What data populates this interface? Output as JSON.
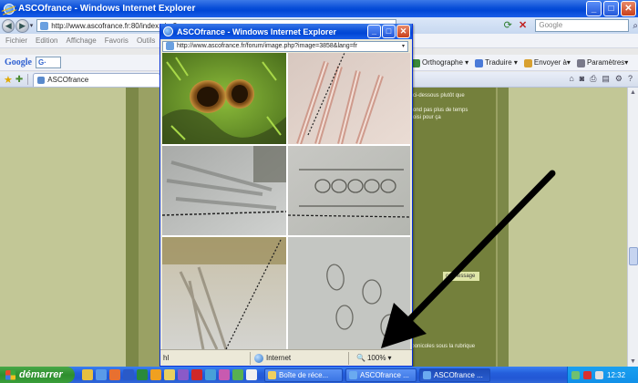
{
  "main_window": {
    "title": "ASCOfrance - Windows Internet Explorer",
    "address": "http://www.ascofrance.fr:80/index.php?...",
    "search_placeholder": "Google",
    "menu": [
      "Fichier",
      "Edition",
      "Affichage",
      "Favoris",
      "Outils"
    ],
    "google_label": "Google",
    "google_g": "G·",
    "toolbar_items": [
      "Orthographe ▾",
      "Traduire ▾",
      "Envoyer à▾",
      "Paramètres▾"
    ],
    "tab_label": "ASCOfrance"
  },
  "page_text": {
    "line1": "ci-dessous plutôt que",
    "line2": "ond pas plus de temps",
    "line3": "oisi pour ça",
    "message_button": "ce message",
    "bottom_text": "Vu d'ici, je pense à Tricharina praecox. Vous trouvez une clé des espèces carbonicoles sous la rubrique documentation de notre forum"
  },
  "popup": {
    "title": "ASCOfrance - Windows Internet Explorer",
    "address": "http://www.ascofrance.fr/forum/image.php?image=3858&lang=fr",
    "status_text": "hl",
    "zone_label": "Internet",
    "zoom_label": "100%"
  },
  "taskbar": {
    "start_label": "démarrer",
    "buttons": [
      "Boîte de réce...",
      "ASCOfrance ...",
      "ASCOfrance ..."
    ],
    "clock": "12:32"
  },
  "colors": {
    "xp_blue": "#0a4fd8",
    "page_olive": "#7c8848",
    "arrow": "#000000"
  }
}
